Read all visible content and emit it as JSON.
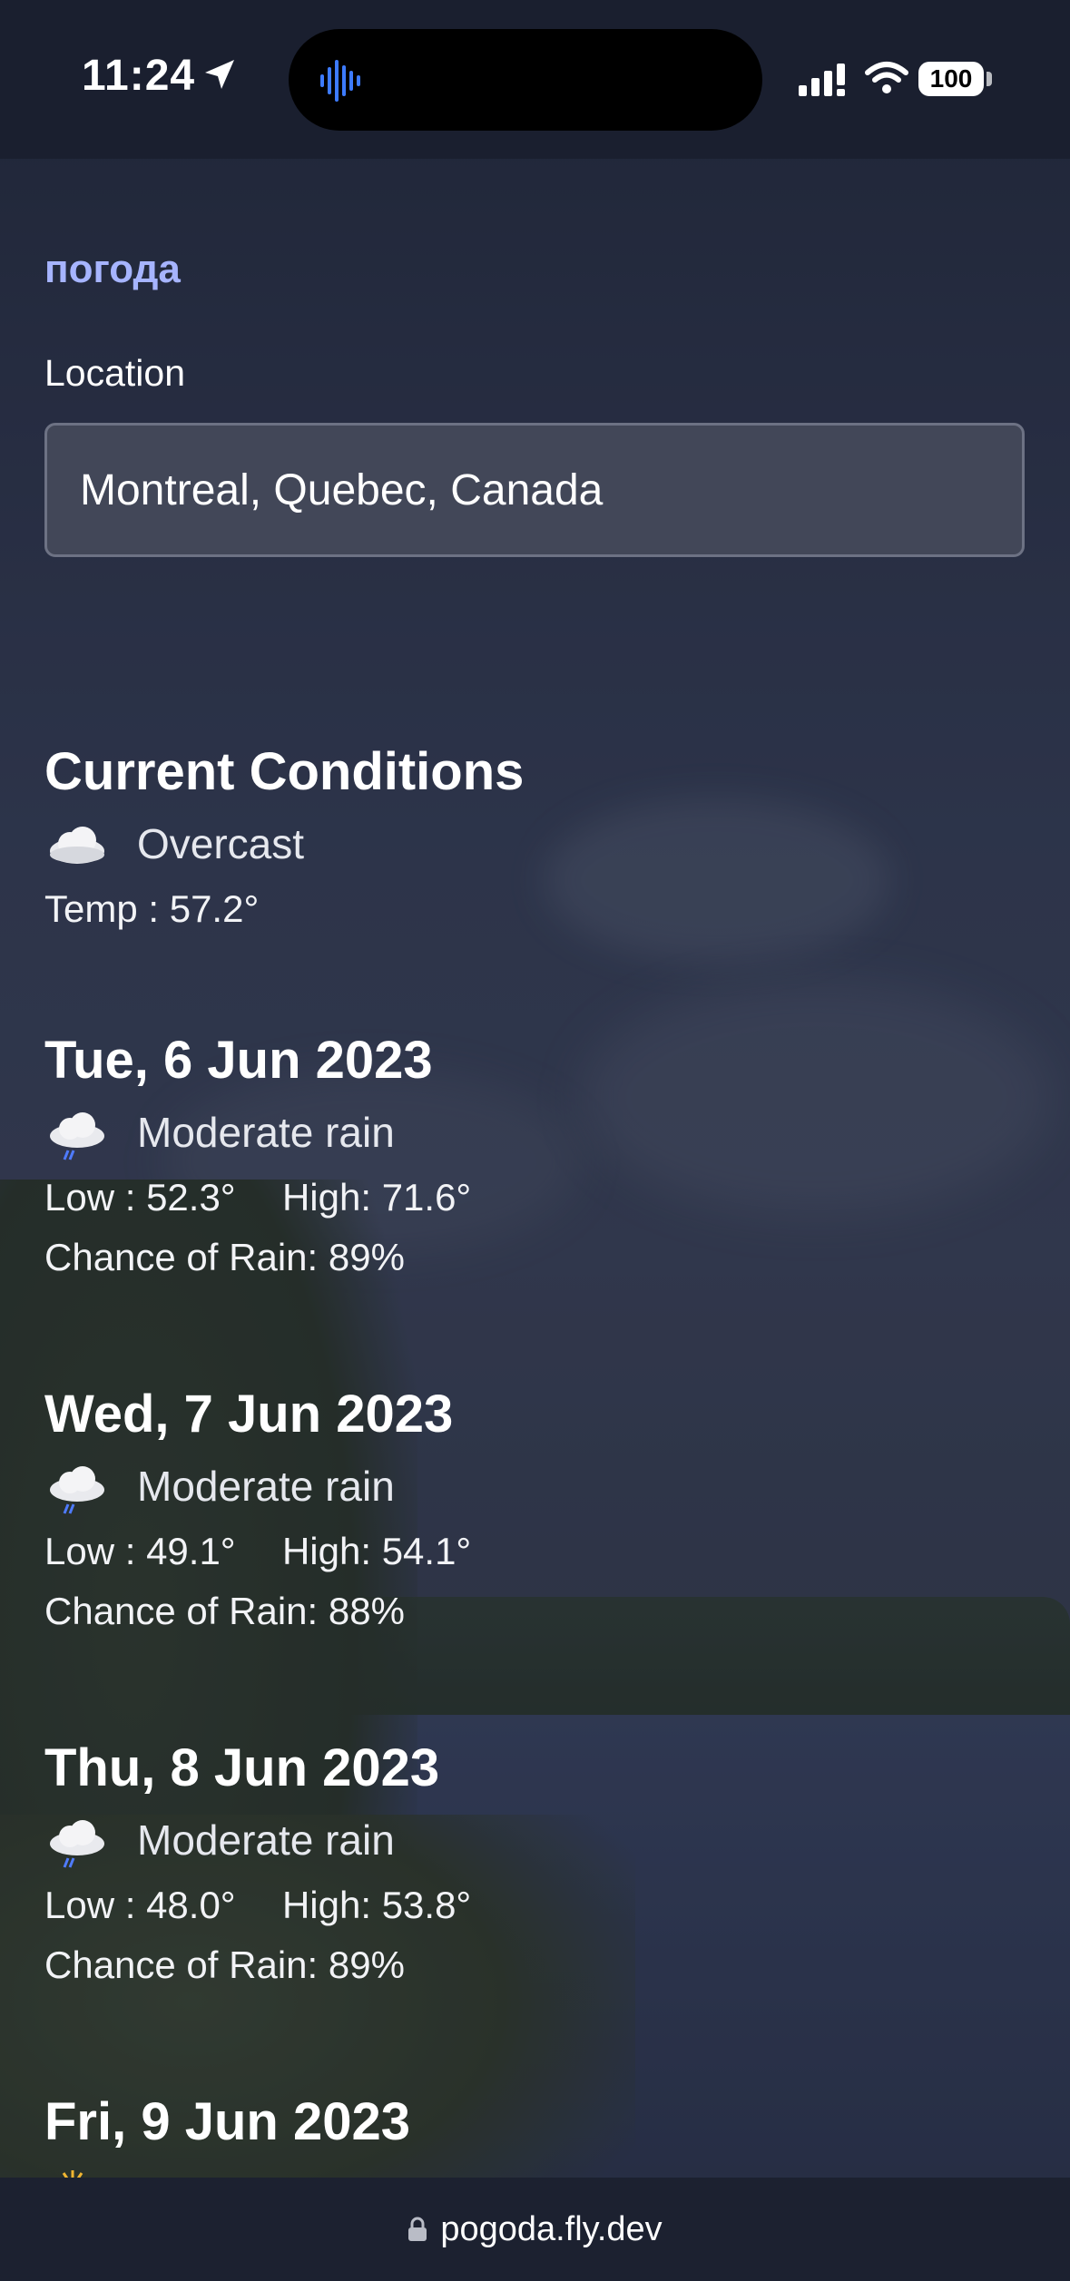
{
  "status_bar": {
    "time": "11:24",
    "battery": "100"
  },
  "app": {
    "brand": "погода",
    "location_label": "Location",
    "location_value": "Montreal, Quebec, Canada"
  },
  "current": {
    "heading": "Current Conditions",
    "condition": "Overcast",
    "condition_icon": "cloud-icon",
    "temp_label": "Temp :",
    "temp_value": "57.2°"
  },
  "forecast": [
    {
      "date": "Tue, 6 Jun 2023",
      "condition": "Moderate rain",
      "condition_icon": "rain-cloud-icon",
      "low_label": "Low :",
      "low": "52.3°",
      "high_label": "High:",
      "high": "71.6°",
      "rain_label": "Chance of Rain:",
      "rain": "89%"
    },
    {
      "date": "Wed, 7 Jun 2023",
      "condition": "Moderate rain",
      "condition_icon": "rain-cloud-icon",
      "low_label": "Low :",
      "low": "49.1°",
      "high_label": "High:",
      "high": "54.1°",
      "rain_label": "Chance of Rain:",
      "rain": "88%"
    },
    {
      "date": "Thu, 8 Jun 2023",
      "condition": "Moderate rain",
      "condition_icon": "rain-cloud-icon",
      "low_label": "Low :",
      "low": "48.0°",
      "high_label": "High:",
      "high": "53.8°",
      "rain_label": "Chance of Rain:",
      "rain": "89%"
    },
    {
      "date": "Fri, 9 Jun 2023",
      "condition_icon": "sun-icon"
    }
  ],
  "browser": {
    "url": "pogoda.fly.dev"
  },
  "colors": {
    "brand": "#a6b4ff",
    "status_bar_bg": "#1a1f2f",
    "input_bg": "#444a5a",
    "rain_drop": "#4f7bff",
    "sun": "#f2b632"
  }
}
